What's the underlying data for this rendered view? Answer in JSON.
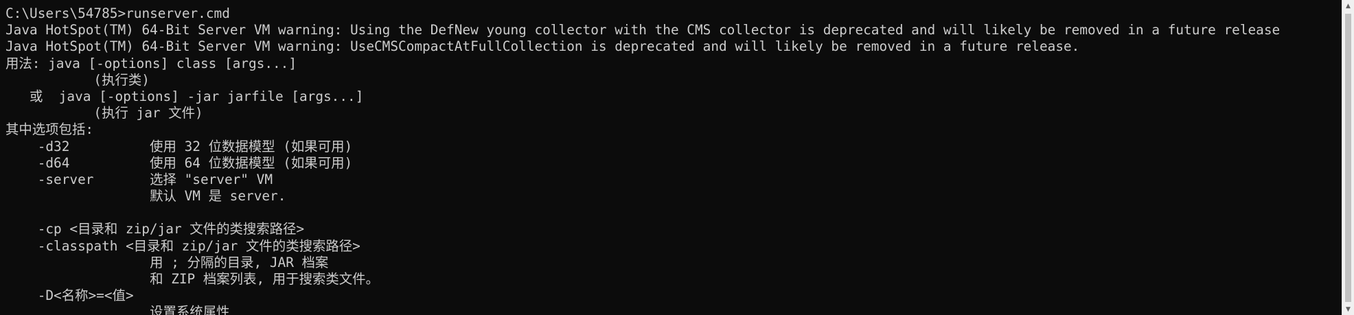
{
  "console": {
    "lines": [
      "C:\\Users\\54785>runserver.cmd",
      "Java HotSpot(TM) 64-Bit Server VM warning: Using the DefNew young collector with the CMS collector is deprecated and will likely be removed in a future release",
      "Java HotSpot(TM) 64-Bit Server VM warning: UseCMSCompactAtFullCollection is deprecated and will likely be removed in a future release.",
      "用法: java [-options] class [args...]",
      "           (执行类)",
      "   或  java [-options] -jar jarfile [args...]",
      "           (执行 jar 文件)",
      "其中选项包括:",
      "    -d32          使用 32 位数据模型 (如果可用)",
      "    -d64          使用 64 位数据模型 (如果可用)",
      "    -server       选择 \"server\" VM",
      "                  默认 VM 是 server.",
      "",
      "    -cp <目录和 zip/jar 文件的类搜索路径>",
      "    -classpath <目录和 zip/jar 文件的类搜索路径>",
      "                  用 ; 分隔的目录, JAR 档案",
      "                  和 ZIP 档案列表, 用于搜索类文件。",
      "    -D<名称>=<值>",
      "                  设置系统属性"
    ]
  },
  "colors": {
    "background": "#0c0c0c",
    "text": "#cccccc"
  },
  "icons": {
    "scroll_up": "chevron-up-icon",
    "scroll_down": "chevron-down-icon"
  }
}
